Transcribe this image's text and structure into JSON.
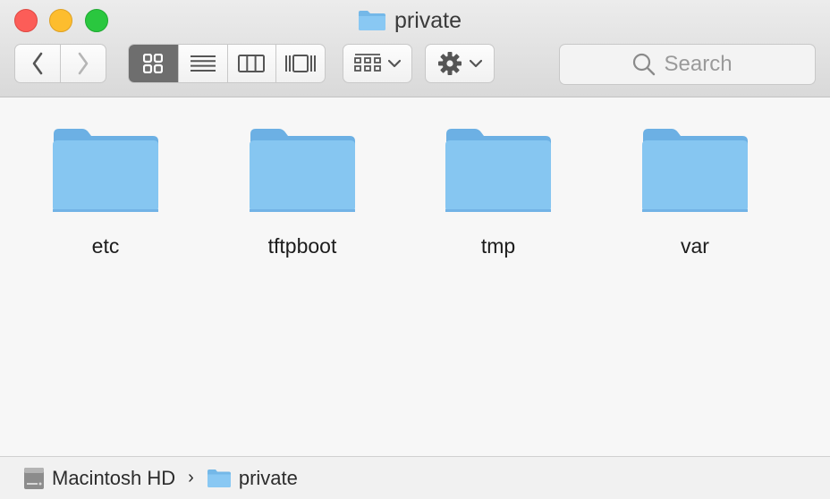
{
  "window": {
    "title": "private",
    "title_icon": "folder-icon"
  },
  "toolbar": {
    "back_icon": "chevron-left-icon",
    "forward_icon": "chevron-right-icon",
    "view_modes": [
      {
        "name": "icon-view",
        "icon": "grid-icon",
        "active": true
      },
      {
        "name": "list-view",
        "icon": "list-icon",
        "active": false
      },
      {
        "name": "column-view",
        "icon": "columns-icon",
        "active": false
      },
      {
        "name": "gallery-view",
        "icon": "gallery-icon",
        "active": false
      }
    ],
    "arrange_icon": "arrange-grid-icon",
    "action_icon": "gear-icon"
  },
  "search": {
    "placeholder": "Search"
  },
  "items": [
    {
      "name": "etc",
      "kind": "folder"
    },
    {
      "name": "tftpboot",
      "kind": "folder"
    },
    {
      "name": "tmp",
      "kind": "folder"
    },
    {
      "name": "var",
      "kind": "folder"
    }
  ],
  "path": {
    "crumbs": [
      {
        "label": "Macintosh HD",
        "icon": "hard-drive-icon"
      },
      {
        "label": "private",
        "icon": "folder-icon"
      }
    ]
  },
  "colors": {
    "folder_light": "#86c6f1",
    "folder_dark": "#6cb0e4",
    "close": "#fc5d58",
    "minimize": "#fdbd2e",
    "zoom": "#2ac73f"
  }
}
